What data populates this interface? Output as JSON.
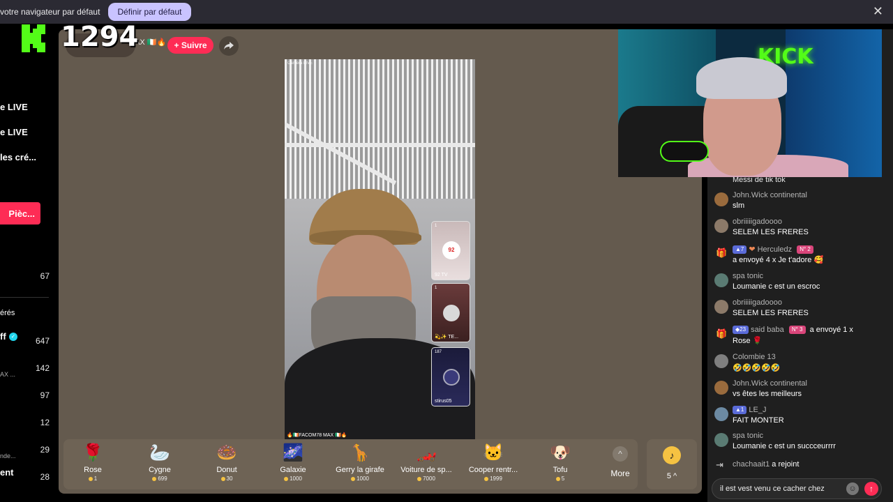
{
  "browser_bar": {
    "message": "votre navigateur par défaut",
    "set_default_label": "Définir par défaut",
    "close": "✕"
  },
  "overlay": {
    "score": "1294"
  },
  "sidebar": {
    "items": [
      {
        "label": "e LIVE"
      },
      {
        "label": "e LIVE"
      },
      {
        "label": " les cré..."
      }
    ],
    "coins_button": " Pièc...",
    "section_count": "67",
    "section_label": "érés",
    "following": [
      {
        "name": "ff",
        "count": "647",
        "sub": ""
      },
      {
        "name": "",
        "count": "142",
        "sub": "AX ..."
      },
      {
        "name": "",
        "count": "97",
        "sub": ""
      },
      {
        "name": "",
        "count": "12",
        "sub": ""
      },
      {
        "name": "",
        "count": "29",
        "sub": "nde..."
      },
      {
        "name": "ent",
        "count": "28",
        "sub": ""
      }
    ]
  },
  "stream": {
    "host_name": "IAX 🇮🇪🔥",
    "follow_label": "+ Suivre",
    "watermark": "Caméra LIVE",
    "caption": "🔥🇮🇪FACOM78 MAX 🇮🇪🔥",
    "side_cards": [
      {
        "count": "1",
        "name": "92 TV"
      },
      {
        "count": "1",
        "name": "💫✨ TE..."
      },
      {
        "count": "187",
        "name": "stirus05"
      }
    ]
  },
  "gifts": [
    {
      "name": "Rose",
      "price": "1",
      "icon": "rose-icon",
      "glyph": "🌹"
    },
    {
      "name": "Cygne",
      "price": "699",
      "icon": "swan-icon",
      "glyph": "🦢"
    },
    {
      "name": "Donut",
      "price": "30",
      "icon": "donut-icon",
      "glyph": "🍩"
    },
    {
      "name": "Galaxie",
      "price": "1000",
      "icon": "galaxy-icon",
      "glyph": "🌌"
    },
    {
      "name": "Gerry la girafe",
      "price": "1000",
      "icon": "giraffe-icon",
      "glyph": "🦒"
    },
    {
      "name": "Voiture de sp...",
      "price": "7000",
      "icon": "sports-car-icon",
      "glyph": "🏎️"
    },
    {
      "name": "Cooper rentr...",
      "price": "1999",
      "icon": "cat-icon",
      "glyph": "🐱"
    },
    {
      "name": "Tofu",
      "price": "5",
      "icon": "tofu-icon",
      "glyph": "🐶"
    }
  ],
  "more_label": "More",
  "coins_count": "5 ^",
  "chat": {
    "top_text": "Messi de tik tok",
    "messages": [
      {
        "user": "John.Wick continental",
        "text": "slm",
        "avatar": "#9a6b3d"
      },
      {
        "user": "obriiiiigadoooo",
        "text": "SELEM LES FRERES",
        "avatar": "#8c7a69"
      },
      {
        "gift": true,
        "level": "7",
        "rank": "N° 2",
        "user": "Herculedz",
        "text": "a envoyé 4 x Je t'adore 🥰"
      },
      {
        "user": "spa tonic",
        "text": "Loumanie c est un escroc",
        "avatar": "#5a7b73"
      },
      {
        "user": "obriiiiigadoooo",
        "text": "SELEM LES FRERES",
        "avatar": "#8c7a69"
      },
      {
        "gift": true,
        "level": "23",
        "rank": "N° 3",
        "user": "said baba",
        "text": "a envoyé 1 x",
        "text2": "Rose 🌹"
      },
      {
        "user": "Colombie 13",
        "text": "🤣🤣🤣🤣🤣",
        "avatar": "#7f7f7f"
      },
      {
        "user": "John.Wick continental",
        "text": "vs êtes les meilleurs",
        "avatar": "#9a6b3d"
      },
      {
        "level": "1",
        "user": "LE_J",
        "text": "FAIT MONTER",
        "avatar": "#6c8aa3"
      },
      {
        "user": "spa tonic",
        "text": "Loumanie c est un succceurrrr",
        "avatar": "#5a7b73"
      }
    ],
    "join_user": "chachaait1",
    "join_text": "a rejoint",
    "input_value": "il est vest venu ce cacher chez"
  },
  "colors": {
    "accent": "#fe2c55",
    "kick_green": "#53fc18",
    "coin": "#f5c242"
  }
}
